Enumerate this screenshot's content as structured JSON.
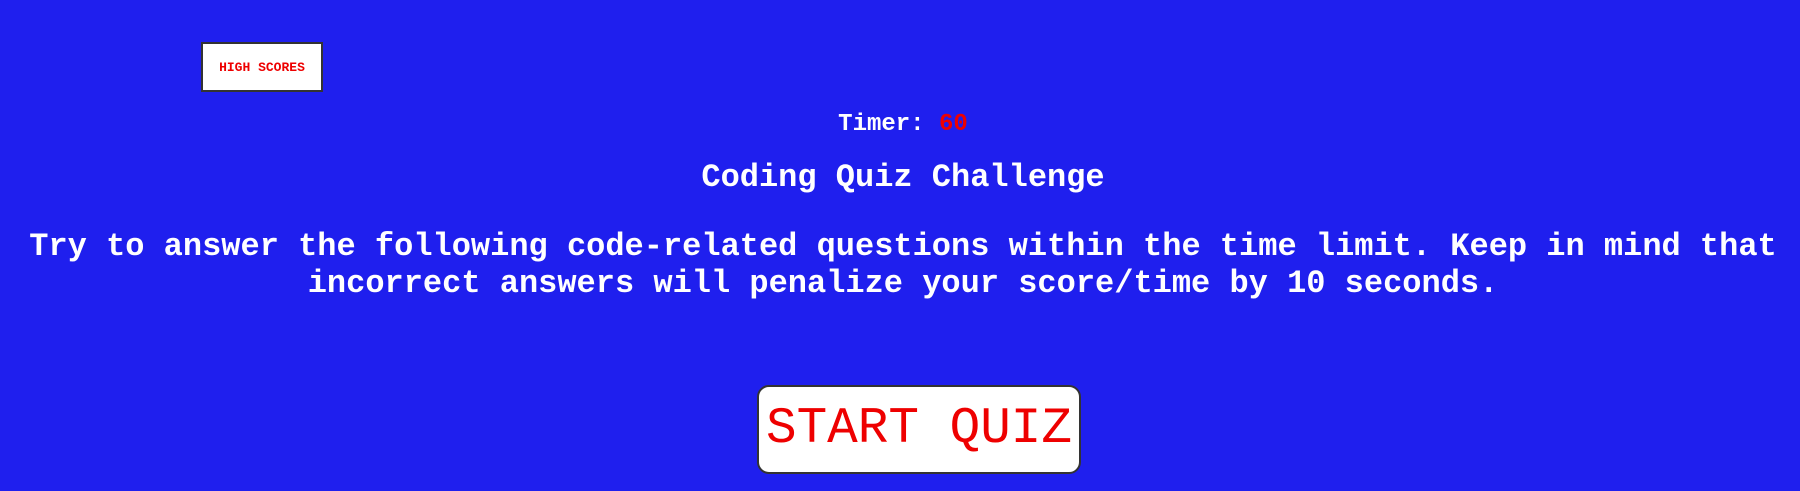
{
  "header": {
    "high_scores_label": "HIGH SCORES"
  },
  "timer": {
    "label": "Timer:",
    "value": "60"
  },
  "main": {
    "title": "Coding Quiz Challenge",
    "description": "Try to answer the following code-related questions within the time limit. Keep in mind that incorrect answers will penalize your score/time by 10 seconds.",
    "start_label": "START QUIZ"
  },
  "colors": {
    "background": "#1f1fee",
    "accent": "#ee0000",
    "text": "#ffffff"
  }
}
